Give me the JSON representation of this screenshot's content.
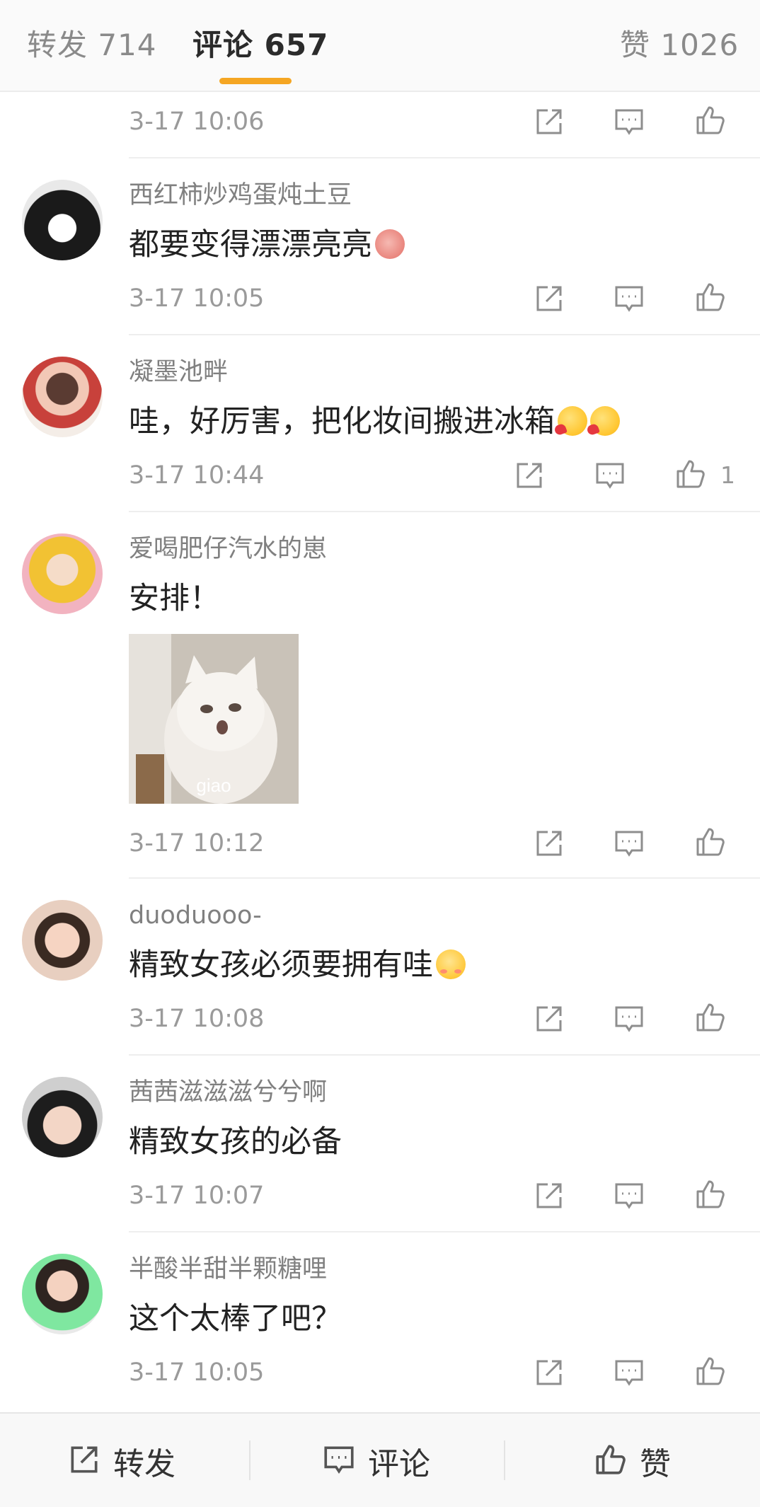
{
  "tabs": {
    "repost": "转发 714",
    "comment": "评论 657",
    "like": "赞 1026"
  },
  "colors": {
    "accent_underline": "#f5a623",
    "icon_gray": "#8e8e8e"
  },
  "first_row": {
    "time": "3-17 10:06"
  },
  "comments": [
    {
      "user": "西红柿炒鸡蛋炖土豆",
      "text": "都要变得漂漂亮亮",
      "emoji": "pig-emoji",
      "time": "3-17 10:05"
    },
    {
      "user": "凝墨池畔",
      "text": "哇，好厉害，把化妆间搬进冰箱",
      "emoji": "kiss-emoji",
      "time": "3-17 10:44",
      "likes": "1"
    },
    {
      "user": "爱喝肥仔汽水的崽",
      "text": "安排！",
      "image_caption": "giao",
      "time": "3-17 10:12"
    },
    {
      "user": "duoduooo-",
      "text": "精致女孩必须要拥有哇",
      "emoji": "shy-emoji",
      "time": "3-17 10:08"
    },
    {
      "user": "茜茜滋滋滋兮兮啊",
      "text": "精致女孩的必备",
      "time": "3-17 10:07"
    },
    {
      "user": "半酸半甜半颗糖哩",
      "text": "这个太棒了吧？",
      "time": "3-17 10:05"
    }
  ],
  "bottom_bar": {
    "repost": "转发",
    "comment": "评论",
    "like": "赞"
  }
}
